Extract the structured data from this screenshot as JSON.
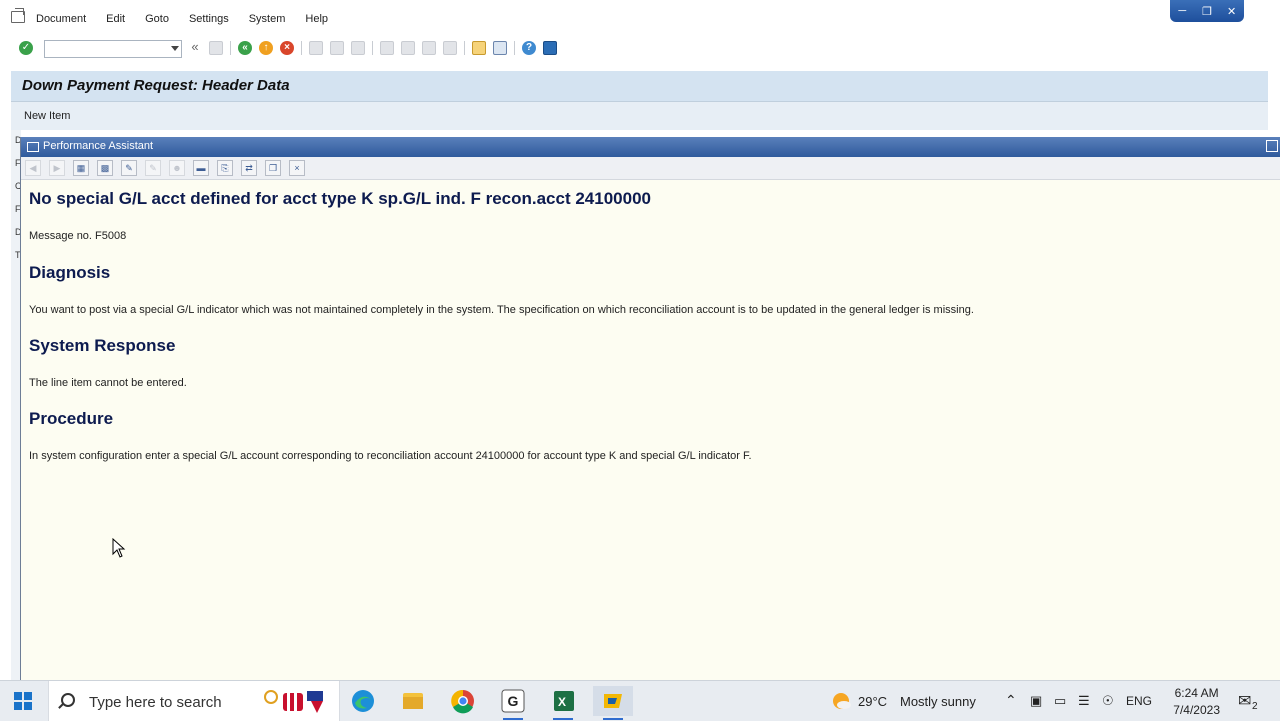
{
  "menu": {
    "items": [
      "Document",
      "Edit",
      "Goto",
      "Settings",
      "System",
      "Help"
    ]
  },
  "window_controls": [
    "minimize",
    "restore",
    "close"
  ],
  "toolbar": {
    "command_field_value": "",
    "nav_back_glyph": "«"
  },
  "screen": {
    "title": "Down Payment Request: Header Data",
    "appbar_button": "New Item",
    "left_strip_letters": [
      "D",
      "F",
      "C",
      "F",
      "D",
      "T"
    ]
  },
  "assistant": {
    "window_title": "Performance Assistant",
    "message_title": "No special G/L acct defined for acct type K sp.G/L ind. F recon.acct 24100000",
    "message_no": "Message no. F5008",
    "diagnosis_heading": "Diagnosis",
    "diagnosis_text": "You want to post via a special G/L indicator which was not maintained completely in the system. The specification on which reconciliation account is to be updated in the general ledger is missing.",
    "system_response_heading": "System Response",
    "system_response_text": "The line item cannot be entered.",
    "procedure_heading": "Procedure",
    "procedure_text": "In system configuration enter a special G/L account corresponding to reconciliation account 24100000 for account type K and special G/L indicator F."
  },
  "taskbar": {
    "search_placeholder": "Type here to search",
    "weather_temp": "29°C",
    "weather_desc": "Mostly sunny",
    "language": "ENG",
    "time": "6:24 AM",
    "date": "7/4/2023",
    "notification_count": "2",
    "apps": [
      "edge-icon",
      "file-explorer-icon",
      "chrome-icon",
      "g-app-icon",
      "excel-icon",
      "sap-icon"
    ]
  },
  "colors": {
    "title_bg": "#d4e3f1",
    "assistant_titlebar": "#2f5a9c",
    "assistant_bg": "#fdfdf2",
    "heading_color": "#0d1b4f"
  }
}
